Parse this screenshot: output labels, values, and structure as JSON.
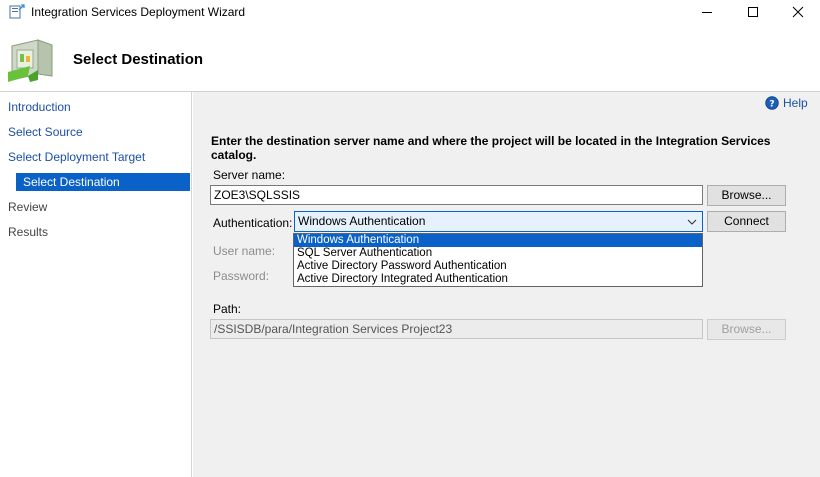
{
  "window": {
    "title": "Integration Services Deployment Wizard"
  },
  "header": {
    "title": "Select Destination"
  },
  "nav": {
    "items": [
      {
        "label": "Introduction"
      },
      {
        "label": "Select Source"
      },
      {
        "label": "Select Deployment Target"
      },
      {
        "label": "Select Destination"
      },
      {
        "label": "Review"
      },
      {
        "label": "Results"
      }
    ],
    "active_index": 3
  },
  "help": {
    "label": "Help"
  },
  "main": {
    "instruction": "Enter the destination server name and where the project will be located in the Integration Services catalog.",
    "server_name_label": "Server name:",
    "server_name_value": "ZOE3\\SQLSSIS",
    "browse_label": "Browse...",
    "authentication_label": "Authentication:",
    "authentication_value": "Windows Authentication",
    "connect_label": "Connect",
    "user_name_label": "User name:",
    "password_label": "Password:",
    "path_label": "Path:",
    "path_value": "/SSISDB/para/Integration Services Project23",
    "path_browse_label": "Browse..."
  },
  "auth_dropdown": {
    "options": [
      "Windows Authentication",
      "SQL Server Authentication",
      "Active Directory Password Authentication",
      "Active Directory Integrated Authentication"
    ],
    "selected_index": 0
  },
  "colors": {
    "accent": "#0a62c9",
    "link": "#1b4fa8",
    "content_bg": "#f0f0f0"
  }
}
